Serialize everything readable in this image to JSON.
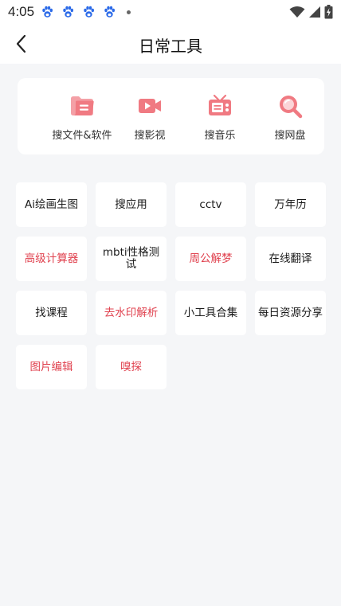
{
  "status_bar": {
    "time": "4:05",
    "notification_icons": [
      "baidu-paw-icon",
      "baidu-paw-icon",
      "baidu-paw-icon",
      "baidu-paw-icon"
    ],
    "system_icons": [
      "wifi-icon",
      "signal-icon",
      "battery-charging-icon"
    ]
  },
  "header": {
    "title": "日常工具",
    "back_icon": "chevron-left-icon"
  },
  "search_bar": {
    "items": [
      {
        "label": "搜文件&软件",
        "icon": "folder-icon"
      },
      {
        "label": "搜影视",
        "icon": "video-icon"
      },
      {
        "label": "搜音乐",
        "icon": "radio-icon"
      },
      {
        "label": "搜网盘",
        "icon": "search-icon"
      }
    ]
  },
  "tools": [
    {
      "label": "Ai绘画生图",
      "color": "#1a1a1a"
    },
    {
      "label": "搜应用",
      "color": "#1a1a1a"
    },
    {
      "label": "cctv",
      "color": "#1a1a1a"
    },
    {
      "label": "万年历",
      "color": "#1a1a1a"
    },
    {
      "label": "高级计算器",
      "color": "#e0424f"
    },
    {
      "label": "mbti性格测试",
      "color": "#1a1a1a"
    },
    {
      "label": "周公解梦",
      "color": "#e0424f"
    },
    {
      "label": "在线翻译",
      "color": "#1a1a1a"
    },
    {
      "label": "找课程",
      "color": "#1a1a1a"
    },
    {
      "label": "去水印解析",
      "color": "#e0424f"
    },
    {
      "label": "小工具合集",
      "color": "#1a1a1a"
    },
    {
      "label": "每日资源分享",
      "color": "#1a1a1a"
    },
    {
      "label": "图片编辑",
      "color": "#e0424f"
    },
    {
      "label": "嗅探",
      "color": "#e0424f"
    }
  ],
  "colors": {
    "accent": "#e0424f",
    "icon_pink": "#f07a82",
    "background": "#f5f6f8",
    "card": "#ffffff"
  }
}
